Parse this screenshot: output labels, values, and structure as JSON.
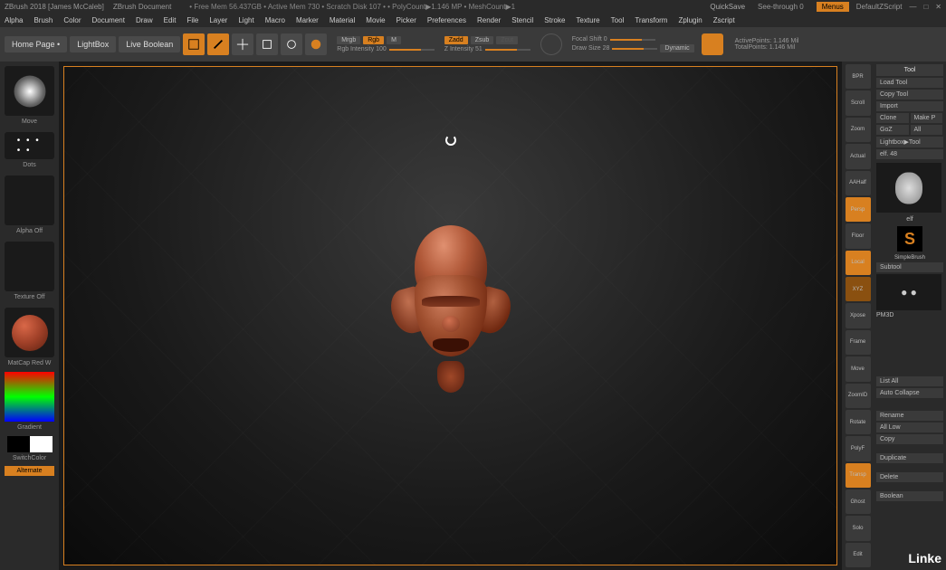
{
  "title": {
    "app": "ZBrush 2018 [James McCaleb]",
    "doc": "ZBrush Document",
    "info": "• Free Mem 56.437GB • Active Mem 730 • Scratch Disk 107 • • PolyCount▶1.146 MP • MeshCount▶1"
  },
  "header": {
    "quicksave": "QuickSave",
    "seethrough": "See-through  0",
    "menus": "Menus",
    "script": "DefaultZScript"
  },
  "menu": [
    "Alpha",
    "Brush",
    "Color",
    "Document",
    "Draw",
    "Edit",
    "File",
    "Layer",
    "Light",
    "Macro",
    "Marker",
    "Material",
    "Movie",
    "Picker",
    "Preferences",
    "Render",
    "Stencil",
    "Stroke",
    "Texture",
    "Tool",
    "Transform",
    "Zplugin",
    "Zscript"
  ],
  "secondary": {
    "home": "Home Page •",
    "lightbox": "LightBox",
    "boolean": "Live Boolean",
    "edit": "Edit",
    "draw": "Draw",
    "move": "Move",
    "scale": "Scale",
    "rotate": "Rotate",
    "mrgb": "Mrgb",
    "rgb": "Rgb",
    "m": "M",
    "rgb_intensity_label": "Rgb Intensity 100",
    "zadd": "Zadd",
    "zsub": "Zsub",
    "zcut": "Zcut",
    "z_intensity_label": "Z Intensity 51",
    "focal_shift": "Focal Shift 0",
    "draw_size": "Draw Size 28",
    "dynamic": "Dynamic",
    "active_points": "ActivePoints: 1.146 Mil",
    "total_points": "TotalPoints: 1.146 Mil"
  },
  "left": {
    "brush": "Move",
    "stroke": "Dots",
    "alpha": "Alpha Off",
    "texture": "Texture Off",
    "material": "MatCap Red W",
    "gradient": "Gradient",
    "switch": "SwitchColor",
    "alternate": "Alternate"
  },
  "right_icons": [
    "BPR",
    "Scroll",
    "Zoom",
    "Actual",
    "AAHalf",
    "Persp",
    "Floor",
    "Local",
    "XYZ",
    "Xpose",
    "Frame",
    "Move",
    "ZoomID",
    "Rotate",
    "PolyF",
    "Transp",
    "Ghost",
    "Solo",
    "Edit"
  ],
  "tool": {
    "header": "Tool",
    "load": "Load Tool",
    "copy": "Copy Tool",
    "import": "Import",
    "clone": "Clone",
    "makep": "Make P",
    "goz": "GoZ",
    "all": "All",
    "lightbox_tool": "Lightbox▶Tool",
    "elf": "elf. 48",
    "elf_name": "elf",
    "simplebrush": "SimpleBrush",
    "subtool": "Subtool",
    "pm3d": "PM3D",
    "listall": "List All",
    "autocollapse": "Auto Collapse",
    "rename": "Rename",
    "alllow": "All Low",
    "copy2": "Copy",
    "duplicate": "Duplicate",
    "delete": "Delete",
    "boolean": "Boolean"
  },
  "linkedin": "Linke"
}
